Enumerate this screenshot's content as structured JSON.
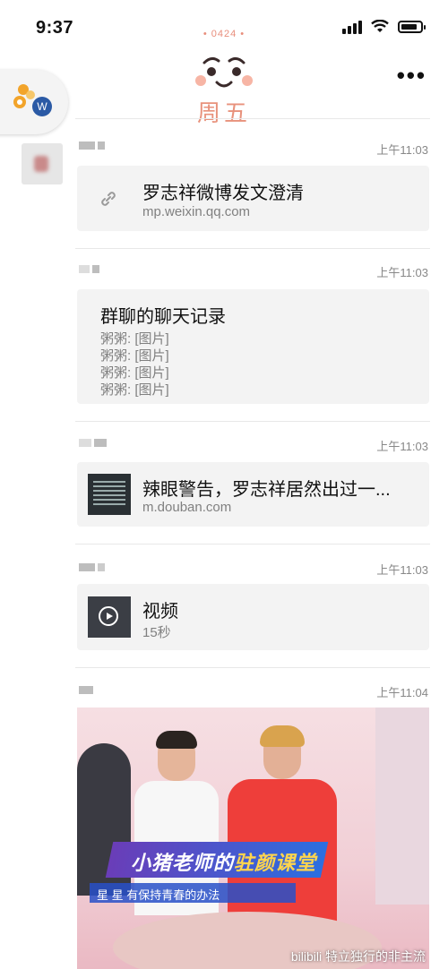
{
  "status_bar": {
    "time": "9:37"
  },
  "header": {
    "date_tag": "• 0424 •",
    "weekday": "周五"
  },
  "more_menu": {
    "label": "•••"
  },
  "float_ball": {
    "badge": "W"
  },
  "messages": [
    {
      "timestamp": "上午11:03",
      "type": "link",
      "title": "罗志祥微博发文澄清",
      "subtitle": "mp.weixin.qq.com"
    },
    {
      "timestamp": "上午11:03",
      "type": "chat_record",
      "title": "群聊的聊天记录",
      "lines": [
        "粥粥: [图片]",
        "粥粥: [图片]",
        "粥粥: [图片]",
        "粥粥: [图片]"
      ]
    },
    {
      "timestamp": "上午11:03",
      "type": "article",
      "title": "辣眼警告，罗志祥居然出过一...",
      "subtitle": "m.douban.com"
    },
    {
      "timestamp": "上午11:03",
      "type": "video",
      "title": "视频",
      "subtitle": "15秒"
    },
    {
      "timestamp": "上午11:04",
      "type": "image"
    }
  ],
  "image_overlay": {
    "caption_main": "小猪老师的",
    "caption_highlight": "驻颜课堂",
    "caption_sub": "星 星  有保持青春的办法",
    "watermark_bottom": "bilibili 特立独行的非主流"
  },
  "colors": {
    "accent": "#e8927c",
    "card_bg": "#f3f3f3",
    "timestamp": "#888888"
  }
}
